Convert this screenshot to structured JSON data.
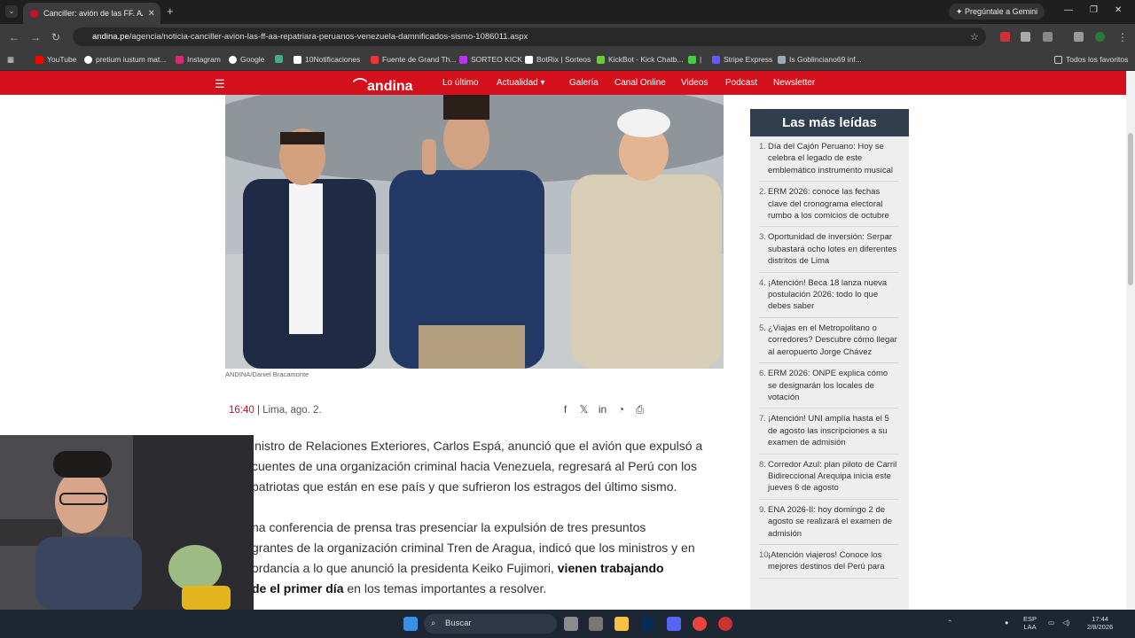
{
  "browser": {
    "tab_title": "Canciller: avión de las FF. AA. re",
    "url_domain": "andina.pe",
    "url_path": "/agencia/noticia-canciller-avion-las-ff-aa-repatriara-peruanos-venezuela-damnificados-sismo-1086011.aspx",
    "gemini_label": "Pregúntale a Gemini",
    "bookmarks": [
      "YouTube",
      "pretium iustum mat...",
      "Instagram",
      "Google",
      "10Notificaciones",
      "Fuente de Grand Th...",
      "SORTEO KICK",
      "BotRix | Sorteos",
      "KickBot - Kick Chatb...",
      "Stripe Express",
      "Is Goblinciano69 inf..."
    ],
    "all_bookmarks": "Todos los favoritos"
  },
  "site": {
    "logo": "andina",
    "nav": [
      "Lo último",
      "Actualidad",
      "Galería",
      "Canal Online",
      "Videos",
      "Podcast",
      "Newsletter"
    ]
  },
  "article": {
    "photo_credit": "ANDINA/Daniel Bracamonte",
    "time": "16:40",
    "location_date": "| Lima, ago. 2.",
    "p1_lines": [
      "inistro de Relaciones Exteriores, Carlos Espá, anunció que el avión que expulsó a",
      "cuentes de una organización criminal hacia Venezuela, regresará al Perú con los",
      "patriotas que están en ese país y que sufrieron los estragos del último sismo."
    ],
    "p2_line1": "na conferencia de prensa tras presenciar la expulsión de tres presuntos",
    "p2_line2": "grantes de la organización criminal Tren de Aragua, indicó que los ministros y en",
    "p2_line3_a": "ordancia a lo que anunció la presidenta Keiko Fujimori,",
    "p2_line3_b": "vienen trabajando",
    "p2_line4_a": "de el primer día",
    "p2_line4_b": "en los temas importantes a resolver."
  },
  "most_read": {
    "title": "Las más leídas",
    "items": [
      {
        "n": "1.",
        "text": "Día del Cajón Peruano: Hoy se celebra el legado de este emblemático instrumento musical"
      },
      {
        "n": "2.",
        "text": "ERM 2026: conoce las fechas clave del cronograma electoral rumbo a los comicios de octubre"
      },
      {
        "n": "3.",
        "text": "Oportunidad de inversión: Serpar subastará ocho lotes en diferentes distritos de Lima"
      },
      {
        "n": "4.",
        "text": "¡Atención! Beca 18 lanza nueva postulación 2026: todo lo que debes saber"
      },
      {
        "n": "5.",
        "text": "¿Viajas en el Metropolitano o corredores? Descubre cómo llegar al aeropuerto Jorge Chávez"
      },
      {
        "n": "6.",
        "text": "ERM 2026: ONPE explica cómo se designarán los locales de votación"
      },
      {
        "n": "7.",
        "text": "¡Atención! UNI amplía hasta el 5 de agosto las inscripciones a su examen de admisión"
      },
      {
        "n": "8.",
        "text": "Corredor Azul: plan piloto de Carril Bidireccional Arequipa inicia este jueves 6 de agosto"
      },
      {
        "n": "9.",
        "text": "ENA 2026-II: hoy domingo 2 de agosto se realizará el examen de admisión"
      },
      {
        "n": "10.",
        "text": "¡Atención viajeros! Conoce los mejores destinos del Perú para"
      }
    ]
  },
  "taskbar": {
    "search": "Buscar",
    "lang_1": "ESP",
    "lang_2": "LAA",
    "time": "17:44",
    "date": "2/8/2026"
  },
  "colors": {
    "site_red": "#d3101b",
    "sidebar_header": "#2f3d4c",
    "time_red": "#c8102e"
  }
}
